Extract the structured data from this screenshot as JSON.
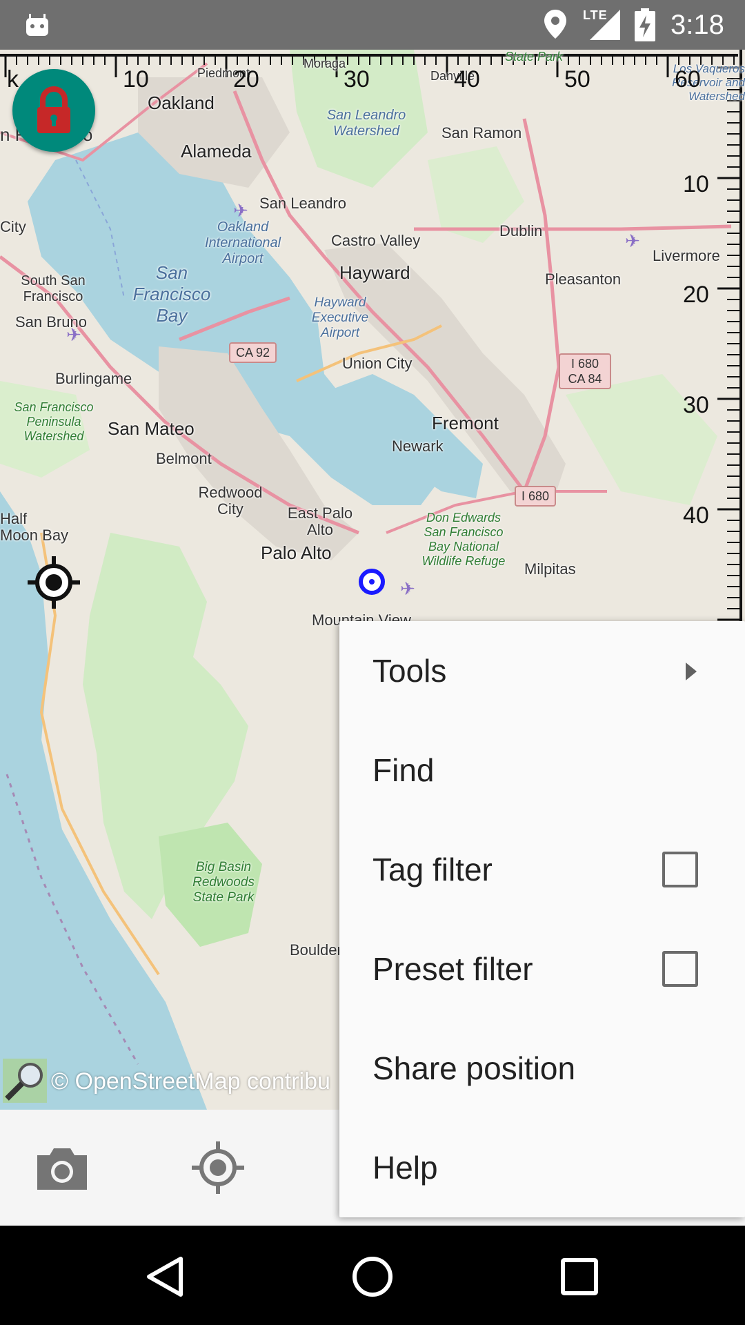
{
  "status_bar": {
    "time": "3:18",
    "network": "LTE",
    "icons": [
      "android-icon",
      "location-icon",
      "signal-icon",
      "battery-charging-icon"
    ]
  },
  "map": {
    "attribution": "© OpenStreetMap contribu",
    "ruler_top_labels": [
      "k",
      "10",
      "20",
      "30",
      "40",
      "50",
      "60"
    ],
    "ruler_right_labels": [
      "10",
      "20",
      "30",
      "40"
    ],
    "places": {
      "oakland": "Oakland",
      "alameda": "Alameda",
      "san_leandro": "San Leandro",
      "oakland_airport": "Oakland International Airport",
      "castro_valley": "Castro Valley",
      "hayward": "Hayward",
      "hayward_airport": "Hayward Executive Airport",
      "union_city": "Union City",
      "fremont": "Fremont",
      "newark": "Newark",
      "san_mateo": "San Mateo",
      "belmont": "Belmont",
      "redwood_city": "Redwood City",
      "east_palo_alto": "East Palo Alto",
      "palo_alto": "Palo Alto",
      "mountain_view": "Mountain View",
      "milpitas": "Milpitas",
      "dublin": "Dublin",
      "pleasanton": "Pleasanton",
      "livermore": "Livermore",
      "san_ramon": "San Ramon",
      "danville": "Danville",
      "moraga": "Moraga",
      "piedmont": "Piedmont",
      "burlingame": "Burlingame",
      "south_sf": "South San Francisco",
      "san_bruno": "San Bruno",
      "daly_city": "City",
      "sf_partial": "n Francisco",
      "half_moon_bay": "Half Moon Bay",
      "boulder": "Boulder",
      "sf_bay": "San Francisco Bay",
      "san_leandro_watershed": "San Leandro Watershed",
      "sf_peninsula_watershed": "San Francisco Peninsula Watershed",
      "don_edwards": "Don Edwards San Francisco Bay National Wildlife Refuge",
      "big_basin": "Big Basin Redwoods State Park",
      "state_park": "State Park",
      "los_vaqueros": "Los Vaqueros Reservoir and Watershed"
    },
    "shields": {
      "ca92": "CA 92",
      "i680_ca84": "I 680 CA 84",
      "i680": "I 680"
    }
  },
  "menu": {
    "items": [
      {
        "label": "Tools",
        "type": "submenu"
      },
      {
        "label": "Find",
        "type": "plain"
      },
      {
        "label": "Tag filter",
        "type": "checkbox",
        "checked": false
      },
      {
        "label": "Preset filter",
        "type": "checkbox",
        "checked": false
      },
      {
        "label": "Share position",
        "type": "plain"
      },
      {
        "label": "Help",
        "type": "plain"
      }
    ]
  },
  "colors": {
    "fab": "#00897b",
    "lock": "#c62828",
    "gps_dot": "#1a1aff",
    "status_bar": "#6f6f6f"
  }
}
